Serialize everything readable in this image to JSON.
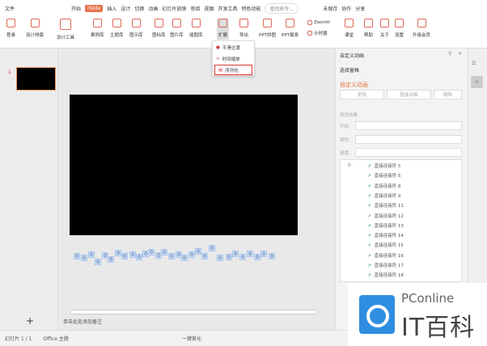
{
  "menubar": {
    "file": "文件",
    "tabs": [
      "开始",
      "iSlide",
      "插入",
      "设计",
      "切换",
      "动画",
      "幻灯片放映",
      "审阅",
      "视图",
      "开发工具",
      "特色功能"
    ],
    "search": "查找命令...",
    "unsaved": "未保存",
    "collab": "协作",
    "share": "分享"
  },
  "ribbon": [
    "登录",
    "设计排版",
    "设计工具",
    "案例库",
    "主题库",
    "图示库",
    "图标库",
    "图片库",
    "插图库",
    "扩展",
    "导出",
    "PPT拼图",
    "PPT瘦身",
    "ZoomIt",
    "计时器",
    "课堂",
    "帮助",
    "关于",
    "设置",
    "升级会员"
  ],
  "dropdown": [
    "平滑过渡",
    "时间缩放",
    "序列化"
  ],
  "slides": {
    "number": "1"
  },
  "zeros": [
    "0",
    "0",
    "0",
    "0",
    "0",
    "0",
    "0",
    "0",
    "0",
    "0",
    "0",
    "0",
    "0",
    "0",
    "0",
    "0",
    "0",
    "0",
    "0",
    "0",
    "0",
    "0",
    "0",
    "0",
    "0",
    "0",
    "0",
    "0",
    "0"
  ],
  "notes": "单击此处添加备注",
  "panel": {
    "title": "自定义动画",
    "select_pane": "选择窗格",
    "section": "自定义动画",
    "change": "更改",
    "smart": "智能动画",
    "delete": "删除",
    "modify": "修改效果",
    "start": "开始:",
    "property": "属性:",
    "speed": "速度:",
    "list_index": "0",
    "items": [
      "直接连接符 5",
      "直接连接符 6",
      "直接连接符 8",
      "直接连接符 9",
      "直接连接符 11",
      "直接连接符 12",
      "直接连接符 13",
      "直接连接符 14",
      "直接连接符 15",
      "直接连接符 16",
      "直接连接符 17",
      "直接连接符 18"
    ]
  },
  "status": {
    "slide": "幻灯片 1 / 1",
    "theme": "Office 主题",
    "beautify": "一键美化"
  },
  "watermark": {
    "brand": "PConline",
    "name": "IT百科"
  }
}
